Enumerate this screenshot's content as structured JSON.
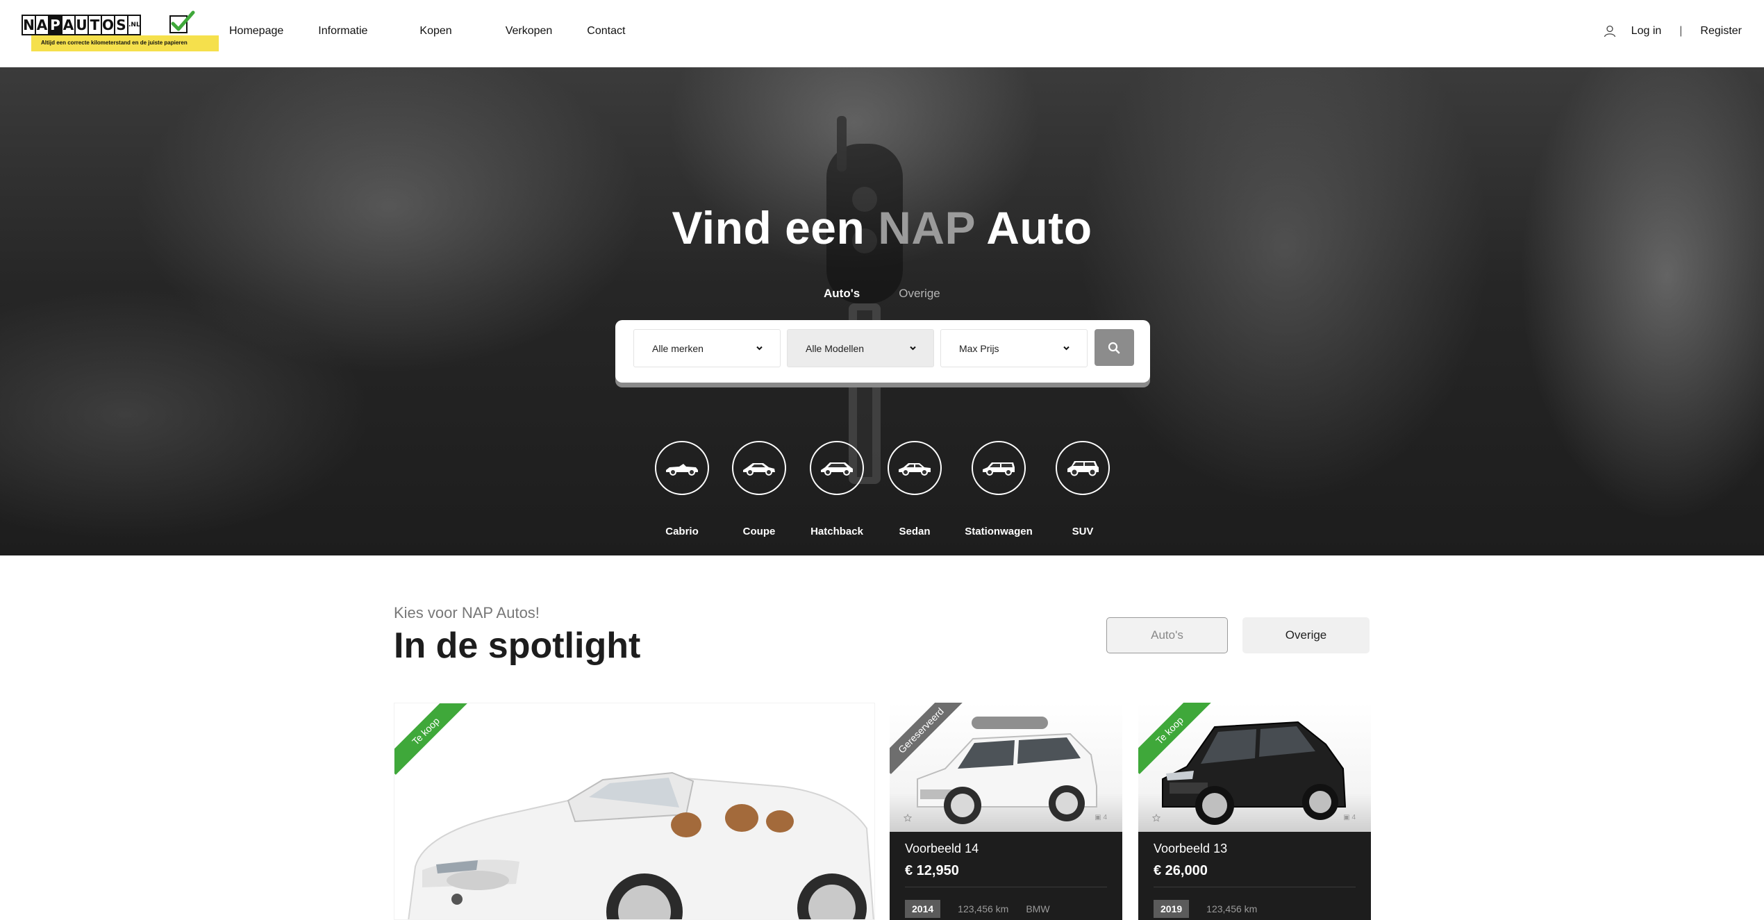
{
  "header": {
    "logo": {
      "letters": [
        "N",
        "A",
        "P",
        "A",
        "U",
        "T",
        "O",
        "S"
      ],
      "tld": ".NL",
      "tagline": "Altijd een correcte kilometerstand en de juiste papieren"
    },
    "nav": [
      "Homepage",
      "Informatie",
      "Kopen",
      "Verkopen",
      "Contact"
    ],
    "login": "Log in",
    "separator": "|",
    "register": "Register"
  },
  "hero": {
    "title_part1": "Vind een",
    "title_highlight": "NAP",
    "title_part2": "Auto",
    "tabs": [
      "Auto's",
      "Overige"
    ],
    "search": {
      "brand": "Alle merken",
      "model": "Alle Modellen",
      "price": "Max Prijs"
    },
    "categories": [
      {
        "label": "Cabrio",
        "icon": "cabrio-icon"
      },
      {
        "label": "Coupe",
        "icon": "coupe-icon"
      },
      {
        "label": "Hatchback",
        "icon": "hatchback-icon"
      },
      {
        "label": "Sedan",
        "icon": "sedan-icon"
      },
      {
        "label": "Stationwagen",
        "icon": "stationwagen-icon"
      },
      {
        "label": "SUV",
        "icon": "suv-icon"
      }
    ]
  },
  "spotlight": {
    "kicker": "Kies voor NAP Autos!",
    "title": "In de spotlight",
    "filters": [
      "Auto's",
      "Overige"
    ],
    "featured": {
      "ribbon": "Te koop"
    },
    "cards": [
      {
        "ribbon": "Gereserveerd",
        "photos": "4",
        "name": "Voorbeeld 14",
        "price": "€ 12,950",
        "year": "2014",
        "km": "123,456 km",
        "brand": "BMW"
      },
      {
        "ribbon": "Te koop",
        "photos": "4",
        "name": "Voorbeeld 13",
        "price": "€ 26,000",
        "year": "2019",
        "km": "123,456 km",
        "brand": ""
      }
    ]
  },
  "colors": {
    "accent_green": "#3fa83a",
    "logo_yellow": "#f5e04c",
    "dark_card": "#1d1d1d",
    "hero_highlight": "#9b9b9b"
  }
}
